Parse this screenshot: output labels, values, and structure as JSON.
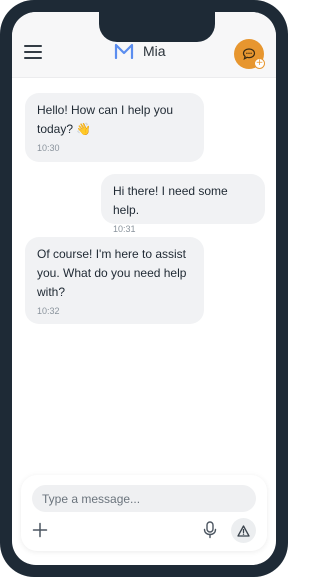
{
  "header": {
    "app_name": "Mia",
    "logo_icon": "m-logo-icon",
    "avatar_icon": "chat-bubble-icon",
    "avatar_badge": "+",
    "accent_color": "#e7962f"
  },
  "messages": [
    {
      "sender": "assistant",
      "text": "Hello! How can I help you today? 👋",
      "time": "10:30"
    },
    {
      "sender": "user",
      "text": "Hi there! I need some help.",
      "time": "10:31"
    },
    {
      "sender": "assistant",
      "text": "Of course! I'm here to assist you. What do you need help with?",
      "time": "10:32"
    }
  ],
  "composer": {
    "placeholder": "Type a message...",
    "value": "",
    "icons": [
      "plus-icon",
      "microphone-icon",
      "warning-icon"
    ]
  }
}
